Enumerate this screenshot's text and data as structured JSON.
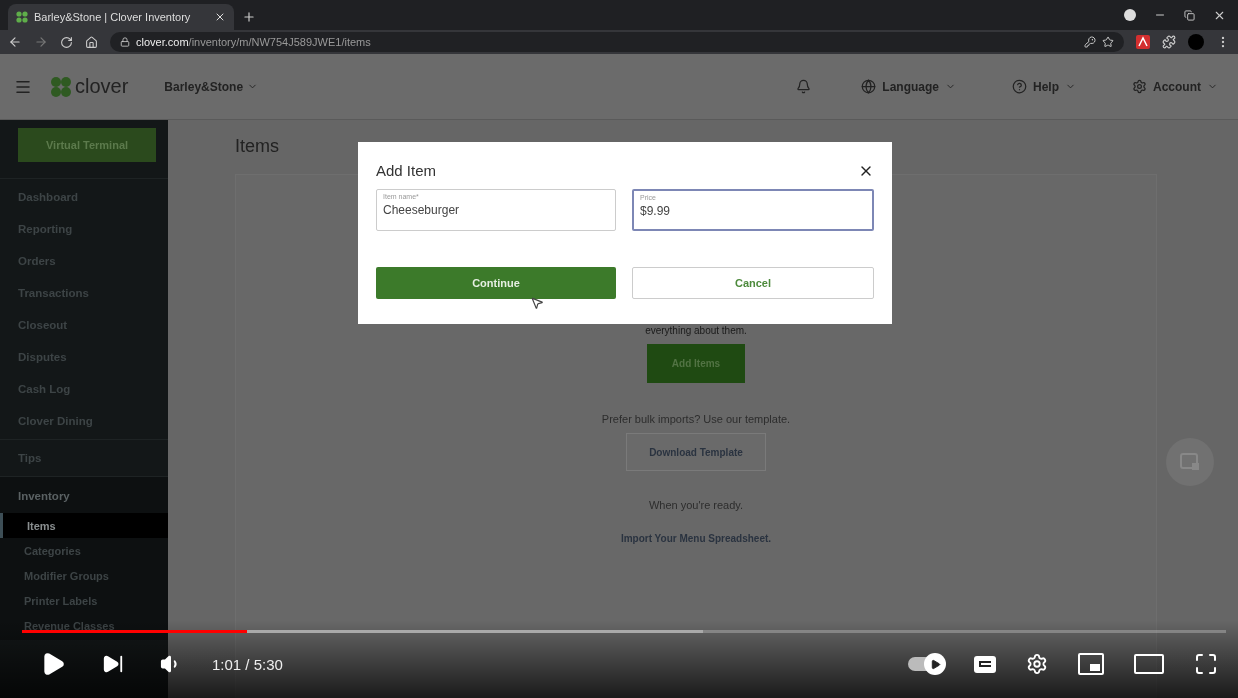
{
  "browser": {
    "tab": {
      "title": "Barley&Stone | Clover Inventory"
    },
    "url": {
      "domain": "clover.com",
      "path": "/inventory/m/NW754J589JWE1/items"
    }
  },
  "app_header": {
    "logo": "clover",
    "business": "Barley&Stone",
    "menus": [
      {
        "kind": "language",
        "label": "Language"
      },
      {
        "kind": "help",
        "label": "Help"
      },
      {
        "kind": "account",
        "label": "Account"
      }
    ]
  },
  "sidebar": {
    "primary_button": "Virtual Terminal",
    "sections": [
      {
        "items": [
          {
            "label": "Dashboard",
            "selected": false
          },
          {
            "label": "Reporting",
            "selected": false
          },
          {
            "label": "Orders",
            "selected": false
          },
          {
            "label": "Transactions",
            "selected": false
          },
          {
            "label": "Closeout",
            "selected": false
          },
          {
            "label": "Disputes",
            "selected": false
          },
          {
            "label": "Cash Log",
            "selected": false
          },
          {
            "label": "Clover Dining",
            "selected": false
          }
        ]
      },
      {
        "items": [
          {
            "label": "Tips",
            "selected": false
          }
        ]
      },
      {
        "items": [
          {
            "label": "Inventory",
            "selected": false,
            "children": [
              {
                "label": "Items",
                "selected": true
              },
              {
                "label": "Categories",
                "selected": false
              },
              {
                "label": "Modifier Groups",
                "selected": false
              },
              {
                "label": "Printer Labels",
                "selected": false
              },
              {
                "label": "Revenue Classes",
                "selected": false
              }
            ]
          }
        ]
      }
    ]
  },
  "page": {
    "title": "Items",
    "empty_state": {
      "text": "everything about them.",
      "add_button": "Add Items",
      "bulk_text": "Prefer bulk imports? Use our template.",
      "download_button": "Download Template",
      "ready_text": "When you're ready.",
      "import_link": "Import Your Menu Spreadsheet."
    }
  },
  "dialog": {
    "title": "Add Item",
    "fields": [
      {
        "label": "Item name*",
        "value": "Cheeseburger",
        "focused": false
      },
      {
        "label": "Price",
        "value": "$9.99",
        "focused": true
      }
    ],
    "buttons": [
      {
        "label": "Continue",
        "kind": "primary"
      },
      {
        "label": "Cancel",
        "kind": "secondary"
      }
    ]
  },
  "player": {
    "progress": {
      "level": 0.187
    },
    "buffer": {
      "level": 0.566
    },
    "time": "1:01 / 5:30",
    "autoplay": {
      "on": true
    }
  }
}
